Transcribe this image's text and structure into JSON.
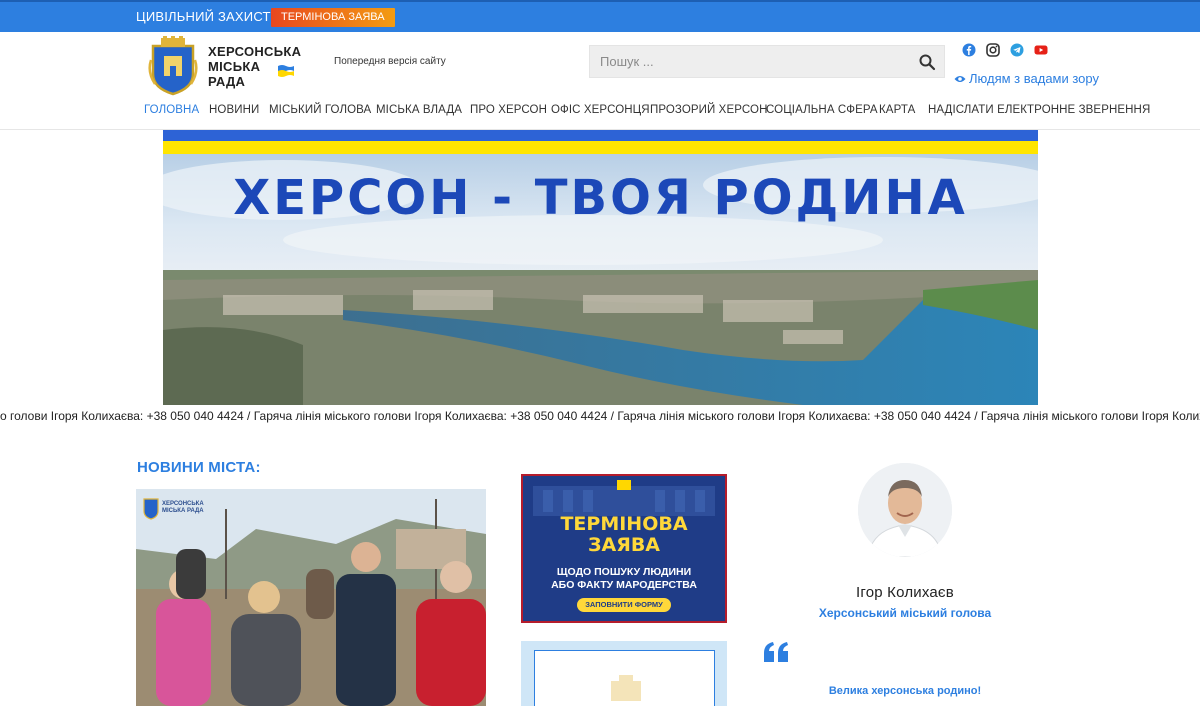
{
  "topbar": {
    "civil_defense": "ЦИВІЛЬНИЙ ЗАХИСТ",
    "urgent_statement": "ТЕРМІНОВА ЗАЯВА"
  },
  "header": {
    "site_title_line1": "ХЕРСОНСЬКА",
    "site_title_line2": "МІСЬКА",
    "site_title_line3": "РАДА",
    "prev_version": "Попередня версія сайту",
    "vision_link": "Людям з вадами зору",
    "social_icons": [
      "facebook-icon",
      "instagram-icon",
      "telegram-icon",
      "youtube-icon"
    ]
  },
  "search": {
    "placeholder": "Пошук ..."
  },
  "nav": {
    "items": [
      {
        "label": "ГОЛОВНА",
        "active": true
      },
      {
        "label": "НОВИНИ"
      },
      {
        "label": "МІСЬКИЙ ГОЛОВА"
      },
      {
        "label": "МІСЬКА ВЛАДА"
      },
      {
        "label": "ПРО ХЕРСОН"
      },
      {
        "label": "ОФІС ХЕРСОНЦЯ"
      },
      {
        "label": "ПРОЗОРИЙ ХЕРСОН"
      },
      {
        "label": "СОЦІАЛЬНА СФЕРА"
      },
      {
        "label": "КАРТА"
      },
      {
        "label": "НАДІСЛАТИ ЕЛЕКТРОННЕ ЗВЕРНЕННЯ"
      }
    ]
  },
  "banner": {
    "headline": "ХЕРСОН - ТВОЯ РОДИНА"
  },
  "ticker": {
    "text": "о голови Ігоря Колихаєва: +38 050 040 4424 / Гаряча лінія міського голови Ігоря Колихаєва: +38 050 040 4424 / Гаряча лінія міського голови Ігоря Колихаєва: +38 050 040 4424 / Гаряча лінія міського голови Ігоря Колихаєва: +38 050 040 4424"
  },
  "news": {
    "section_title": "НОВИНИ МІСТА:",
    "photo_watermark_line1": "ХЕРСОНСЬКА",
    "photo_watermark_line2": "МІСЬКА РАДА"
  },
  "promo": {
    "line1": "ТЕРМІНОВА",
    "line2": "ЗАЯВА",
    "line3": "ЩОДО ПОШУКУ ЛЮДИНИ",
    "line4": "АБО ФАКТУ МАРОДЕРСТВА",
    "button": "ЗАПОВНИТИ ФОРМУ"
  },
  "mayor": {
    "name": "Ігор Колихаєв",
    "role": "Херсонський міський голова",
    "greeting": "Велика херсонська родино!"
  },
  "colors": {
    "brand_blue": "#2d7fe0",
    "urgent_orange": "#f39c12",
    "flag_yellow": "#ffd700"
  }
}
